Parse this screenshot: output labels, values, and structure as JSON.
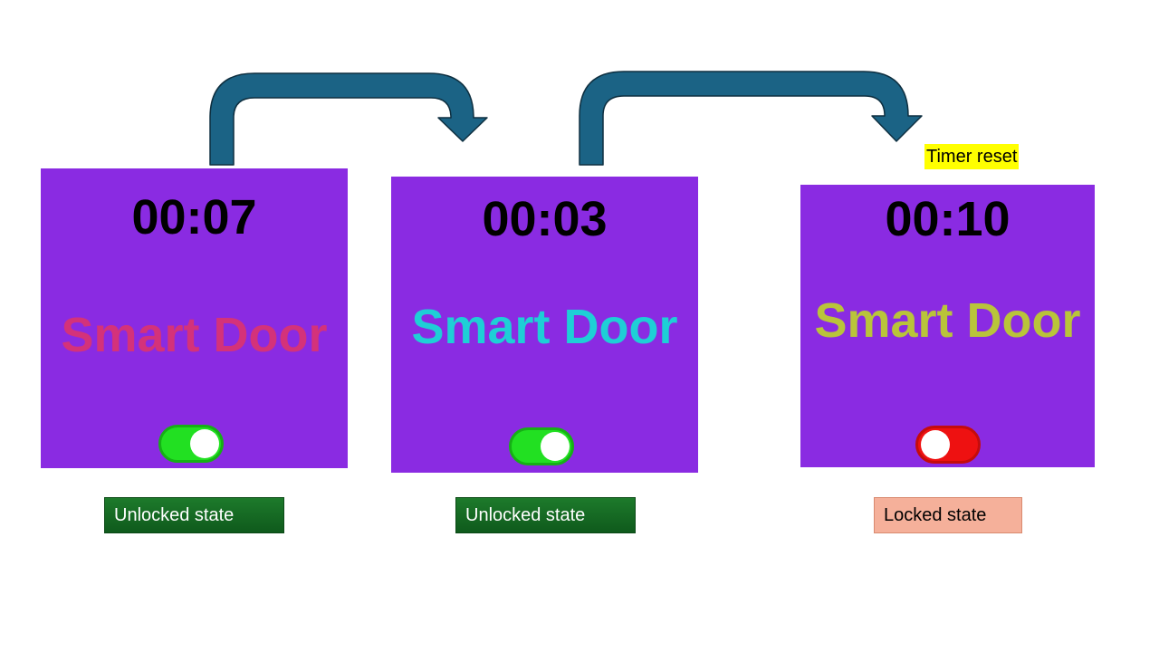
{
  "colors": {
    "panel_bg": "#8a2be2",
    "arrow_fill": "#1b6385",
    "arrow_stroke": "#0e2f40",
    "toggle_on": "#22e022",
    "toggle_off": "#ee1111",
    "timer_reset_highlight": "#ffff00"
  },
  "screens": [
    {
      "timer": "00:07",
      "title": "Smart Door",
      "title_color": "#d4327a",
      "toggle": "on",
      "state_label": "Unlocked state"
    },
    {
      "timer": "00:03",
      "title": "Smart Door",
      "title_color": "#1ecfd6",
      "toggle": "on",
      "state_label": "Unlocked state"
    },
    {
      "timer": "00:10",
      "title": "Smart Door",
      "title_color": "#b9c43a",
      "toggle": "off",
      "state_label": "Locked state"
    }
  ],
  "annotations": {
    "timer_reset": "Timer reset"
  },
  "icons": [
    "curved-arrow-icon",
    "toggle-switch-icon"
  ]
}
